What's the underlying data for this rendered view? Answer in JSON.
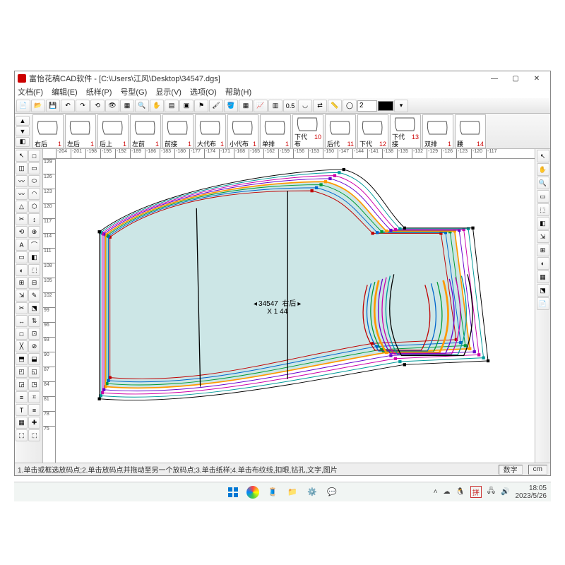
{
  "titlebar": {
    "app_name": "富怡花稿CAD软件",
    "doc_path": "[C:\\Users\\江风\\Desktop\\34547.dgs]"
  },
  "menubar": [
    "文档(F)",
    "编辑(E)",
    "纸样(P)",
    "号型(G)",
    "显示(V)",
    "选项(O)",
    "帮助(H)"
  ],
  "toolbar_icons": [
    "new",
    "open",
    "save",
    "undo",
    "redo",
    "refresh",
    "view",
    "grid",
    "zoom",
    "pan",
    "layer",
    "panel",
    "flag",
    "brush",
    "fill",
    "swatch",
    "graph",
    "table",
    "seam",
    "sleeve",
    "flip",
    "measure",
    "color"
  ],
  "spinner_value": "2",
  "pieces": [
    {
      "name": "右后",
      "count": "1"
    },
    {
      "name": "左后",
      "count": "1"
    },
    {
      "name": "后上",
      "count": "1"
    },
    {
      "name": "左前",
      "count": "1"
    },
    {
      "name": "前接",
      "count": "1"
    },
    {
      "name": "大代布",
      "count": "1"
    },
    {
      "name": "小代布",
      "count": "1"
    },
    {
      "name": "单排",
      "count": "1"
    },
    {
      "name": "下代布",
      "count": "10"
    },
    {
      "name": "后代",
      "count": "11"
    },
    {
      "name": "下代",
      "count": "12"
    },
    {
      "name": "下代接",
      "count": "13"
    },
    {
      "name": "双排",
      "count": "1"
    },
    {
      "name": "腰",
      "count": "14"
    }
  ],
  "hruler_ticks": [
    "-204",
    "-201",
    "-198",
    "-195",
    "-192",
    "-189",
    "-186",
    "-183",
    "-180",
    "-177",
    "-174",
    "-171",
    "-168",
    "-165",
    "-162",
    "-159",
    "-156",
    "-153",
    "-150",
    "-147",
    "-144",
    "-141",
    "-138",
    "-135",
    "-132",
    "-129",
    "-126",
    "-123",
    "-120",
    "-117"
  ],
  "vruler_ticks": [
    "129",
    "126",
    "123",
    "120",
    "117",
    "114",
    "111",
    "108",
    "105",
    "102",
    "99",
    "96",
    "93",
    "90",
    "87",
    "84",
    "81",
    "78",
    "75"
  ],
  "pattern": {
    "id": "34547",
    "name": "右后",
    "grain_label": "X 1   44"
  },
  "statusbar": {
    "hint": "1.单击或框选放码点;2.单击放码点并拖动至另一个放码点;3.单击纸样;4.单击布纹线,扣眼,钻孔,文字,图片",
    "mode": "数字",
    "unit": "cm"
  },
  "right_icons": [
    "ptr",
    "hand",
    "mag",
    "a",
    "b",
    "c",
    "d",
    "e",
    "f",
    "g",
    "h",
    "i"
  ],
  "taskbar": {
    "time": "18:05",
    "date": "2023/5/26"
  },
  "left_tool_count": 46,
  "grade_colors": [
    "#c00000",
    "#0066cc",
    "#009933",
    "#ff9900",
    "#6600cc",
    "#cc00aa",
    "#009999",
    "#000000"
  ]
}
